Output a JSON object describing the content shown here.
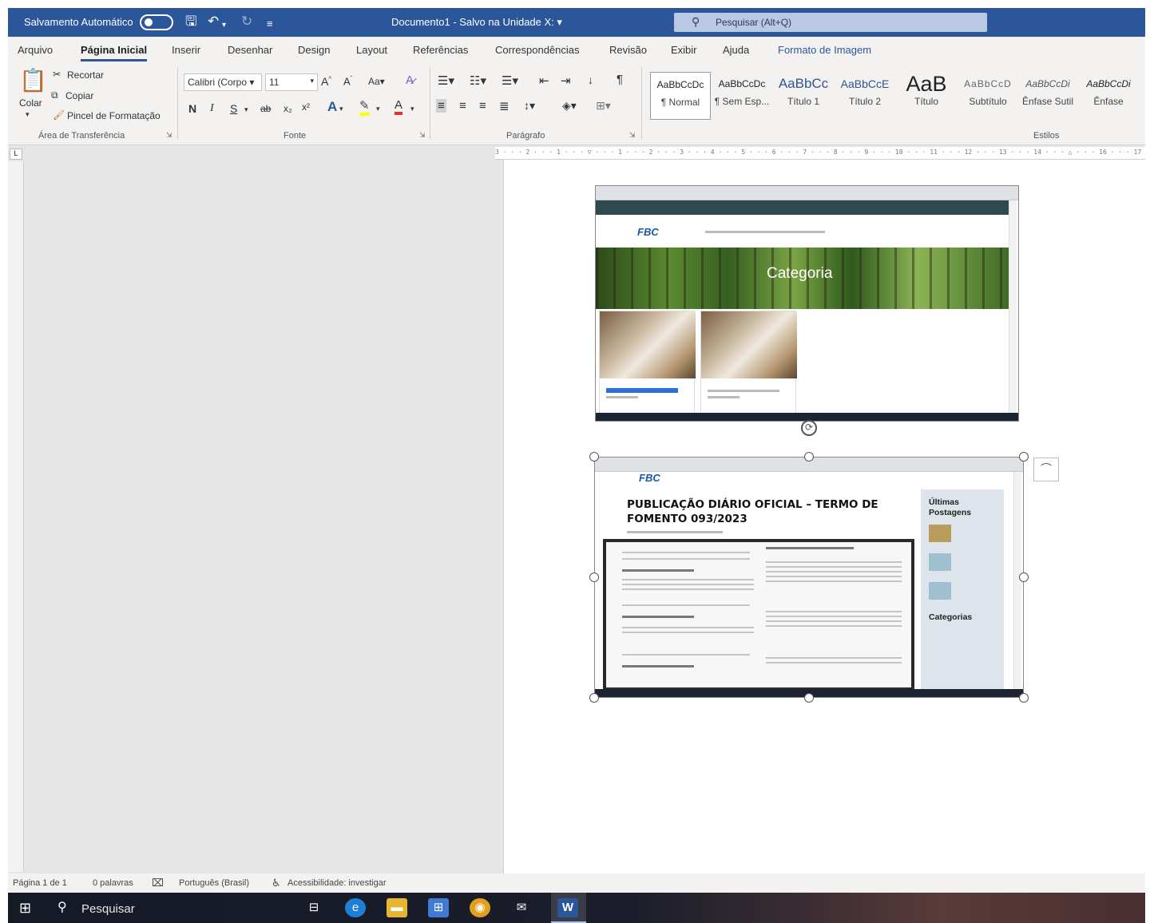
{
  "titlebar": {
    "autosave_label": "Salvamento Automático",
    "doc_title": "Documento1 - Salvo na Unidade X: ▾",
    "search_placeholder": "Pesquisar (Alt+Q)"
  },
  "menu": {
    "tabs": [
      "Arquivo",
      "Página Inicial",
      "Inserir",
      "Desenhar",
      "Design",
      "Layout",
      "Referências",
      "Correspondências",
      "Revisão",
      "Exibir",
      "Ajuda",
      "Formato de Imagem"
    ],
    "active": "Página Inicial",
    "contextual": "Formato de Imagem"
  },
  "ribbon": {
    "clipboard": {
      "paste": "Colar",
      "cut": "Recortar",
      "copy": "Copiar",
      "format_painter": "Pincel de Formatação",
      "label": "Área de Transferência"
    },
    "font": {
      "family": "Calibri (Corpo ▾",
      "size": "11",
      "label": "Fonte",
      "bold": "N",
      "italic": "I",
      "underline": "S"
    },
    "paragraph": {
      "label": "Parágrafo"
    },
    "styles": {
      "label": "Estilos",
      "items": [
        {
          "preview": "AaBbCcDc",
          "name": "¶ Normal"
        },
        {
          "preview": "AaBbCcDc",
          "name": "¶ Sem Esp..."
        },
        {
          "preview": "AaBbCc",
          "name": "Título 1"
        },
        {
          "preview": "AaBbCcE",
          "name": "Título 2"
        },
        {
          "preview": "AaB",
          "name": "Título"
        },
        {
          "preview": "AaBbCcD",
          "name": "Subtítulo"
        },
        {
          "preview": "AaBbCcDi",
          "name": "Ênfase Sutil"
        },
        {
          "preview": "AaBbCcDi",
          "name": "Ênfase"
        }
      ]
    }
  },
  "ruler": {
    "top": "3 · · · 2 · · · 1 · · · ▽ · · · 1 · · · 2 · · · 3 · · · 4 · · · 5 · · · 6 · · · 7 · · · 8 · · · 9 · · · 10 · · · 11 · · · 12 · · · 13 · · · 14 · · · △ · · · 16 · · · 17 · ·",
    "tab_marker": "L"
  },
  "document": {
    "shot1": {
      "hero_title": "Categoria",
      "logo": "FBC"
    },
    "shot2": {
      "logo": "FBC",
      "post_title": "PUBLICAÇÃO DIÁRIO OFICIAL – TERMO DE FOMENTO 093/2023",
      "sidebar_recent": "Últimas Postagens",
      "sidebar_categories": "Categorias"
    }
  },
  "statusbar": {
    "page": "Página 1 de 1",
    "words": "0 palavras",
    "language": "Português (Brasil)",
    "accessibility": "Acessibilidade: investigar"
  },
  "taskbar": {
    "search": "Pesquisar"
  },
  "colors": {
    "word_blue": "#2b579a",
    "ribbon_bg": "#f3f2f1",
    "workspace_bg": "#e6e6e6"
  }
}
